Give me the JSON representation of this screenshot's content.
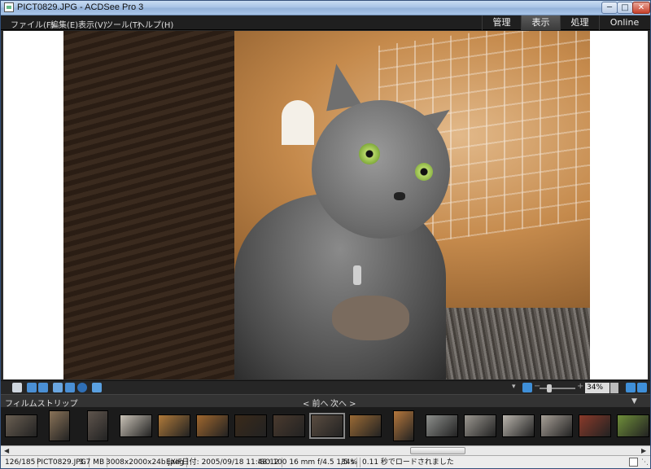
{
  "window": {
    "title": "PICT0829.JPG - ACDSee Pro 3",
    "controls": {
      "minimize": "─",
      "maximize": "□",
      "close": "✕"
    }
  },
  "menu": [
    "ファイル(F)",
    "編集(E)",
    "表示(V)",
    "ツール(T)",
    "ヘルプ(H)"
  ],
  "modes": [
    {
      "label": "管理",
      "active": false
    },
    {
      "label": "表示",
      "active": true
    },
    {
      "label": "処理",
      "active": false
    },
    {
      "label": "Online",
      "active": false
    }
  ],
  "toolbar": {
    "zoom_value": "34%",
    "zoom_minus": "−",
    "zoom_plus": "+",
    "accent": "#3f8fd8"
  },
  "filmstrip": {
    "title": "フィルムストリップ",
    "prev": "< 前へ",
    "next": "次へ >",
    "collapse": "▼",
    "thumbs": [
      {
        "name": "thumb-1",
        "color": "#6a5f52"
      },
      {
        "name": "thumb-2",
        "color": "#8a7358"
      },
      {
        "name": "thumb-3",
        "color": "#5f554d"
      },
      {
        "name": "thumb-4",
        "color": "#c9c2b6"
      },
      {
        "name": "thumb-5",
        "color": "#b07a3a"
      },
      {
        "name": "thumb-6",
        "color": "#a0672e"
      },
      {
        "name": "thumb-7",
        "color": "#3a2a1a"
      },
      {
        "name": "thumb-8",
        "color": "#4a3a2e"
      },
      {
        "name": "thumb-9",
        "color": "#5a4c40",
        "selected": true
      },
      {
        "name": "thumb-10",
        "color": "#9a6a35"
      },
      {
        "name": "thumb-11",
        "color": "#b5773c"
      },
      {
        "name": "thumb-12",
        "color": "#8d8f8c"
      },
      {
        "name": "thumb-13",
        "color": "#9b9790"
      },
      {
        "name": "thumb-14",
        "color": "#b9b4ac"
      },
      {
        "name": "thumb-15",
        "color": "#a79f96"
      },
      {
        "name": "thumb-16",
        "color": "#8a3a2a"
      },
      {
        "name": "thumb-17",
        "color": "#6f8f3a"
      }
    ]
  },
  "status": {
    "index": "126/185",
    "filename": "PICT0829.JPG",
    "filesize": "3.7 MB",
    "dimensions": "3008x2000x24b jpeg",
    "exif_date": "EXIF日付: 2005/09/18 11:48:12",
    "exposure": "ISO 100   16 mm   f/4.5   1/5 s",
    "zoom": "34%",
    "load_time": "0.11 秒でロードされました"
  }
}
